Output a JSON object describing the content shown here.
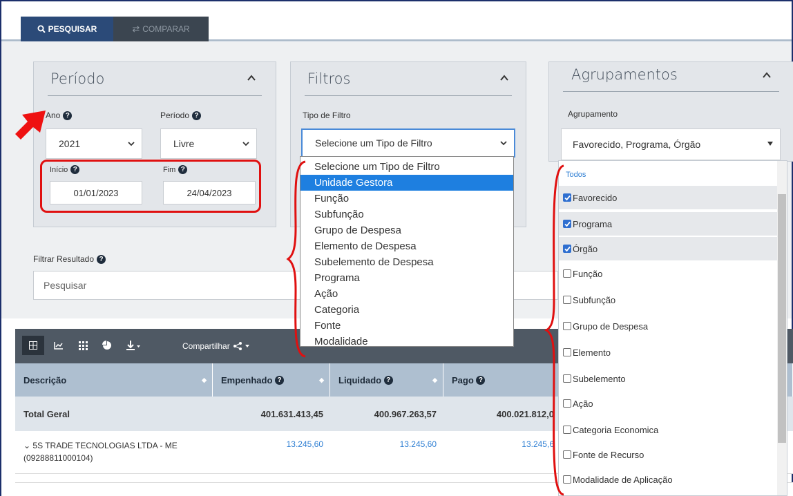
{
  "tabs": {
    "search": "PESQUISAR",
    "compare": "COMPARAR"
  },
  "periodo": {
    "title": "Período",
    "ano_label": "Ano",
    "ano_value": "2021",
    "periodo_label": "Período",
    "periodo_value": "Livre",
    "inicio_label": "Início",
    "inicio_value": "01/01/2023",
    "fim_label": "Fim",
    "fim_value": "24/04/2023"
  },
  "filtros": {
    "title": "Filtros",
    "tipo_label": "Tipo de Filtro",
    "tipo_value": "Selecione um Tipo de Filtro",
    "options": [
      "Selecione um Tipo de Filtro",
      "Unidade Gestora",
      "Função",
      "Subfunção",
      "Grupo de Despesa",
      "Elemento de Despesa",
      "Subelemento de Despesa",
      "Programa",
      "Ação",
      "Categoria",
      "Fonte",
      "Modalidade"
    ]
  },
  "agrupamentos": {
    "title": "Agrupamentos",
    "label": "Agrupamento",
    "value": "Favorecido, Programa, Órgão",
    "todos": "Todos",
    "items": [
      {
        "label": "Favorecido",
        "checked": "true"
      },
      {
        "label": "Programa",
        "checked": "true"
      },
      {
        "label": "Órgão",
        "checked": "true"
      },
      {
        "label": "Função",
        "checked": "false"
      },
      {
        "label": "Subfunção",
        "checked": "false"
      },
      {
        "label": "Grupo de Despesa",
        "checked": "false"
      },
      {
        "label": "Elemento",
        "checked": "false"
      },
      {
        "label": "Subelemento",
        "checked": "false"
      },
      {
        "label": "Ação",
        "checked": "false"
      },
      {
        "label": "Categoria Economica",
        "checked": "false"
      },
      {
        "label": "Fonte de Recurso",
        "checked": "false"
      },
      {
        "label": "Modalidade de Aplicação",
        "checked": "false"
      }
    ]
  },
  "filtrar": {
    "label": "Filtrar Resultado",
    "placeholder": "Pesquisar"
  },
  "toolbar": {
    "share_label": "Compartilhar"
  },
  "table": {
    "headers": {
      "descricao": "Descrição",
      "empenhado": "Empenhado",
      "liquidado": "Liquidado",
      "pago": "Pago"
    },
    "total": {
      "label": "Total Geral",
      "empenhado": "401.631.413,45",
      "liquidado": "400.967.263,57",
      "pago": "400.021.812,0"
    },
    "rows": [
      {
        "name": "5S TRADE TECNOLOGIAS LTDA - ME",
        "doc": "(09288811000104)",
        "empenhado": "13.245,60",
        "liquidado": "13.245,60",
        "pago": "13.245,6"
      }
    ]
  }
}
